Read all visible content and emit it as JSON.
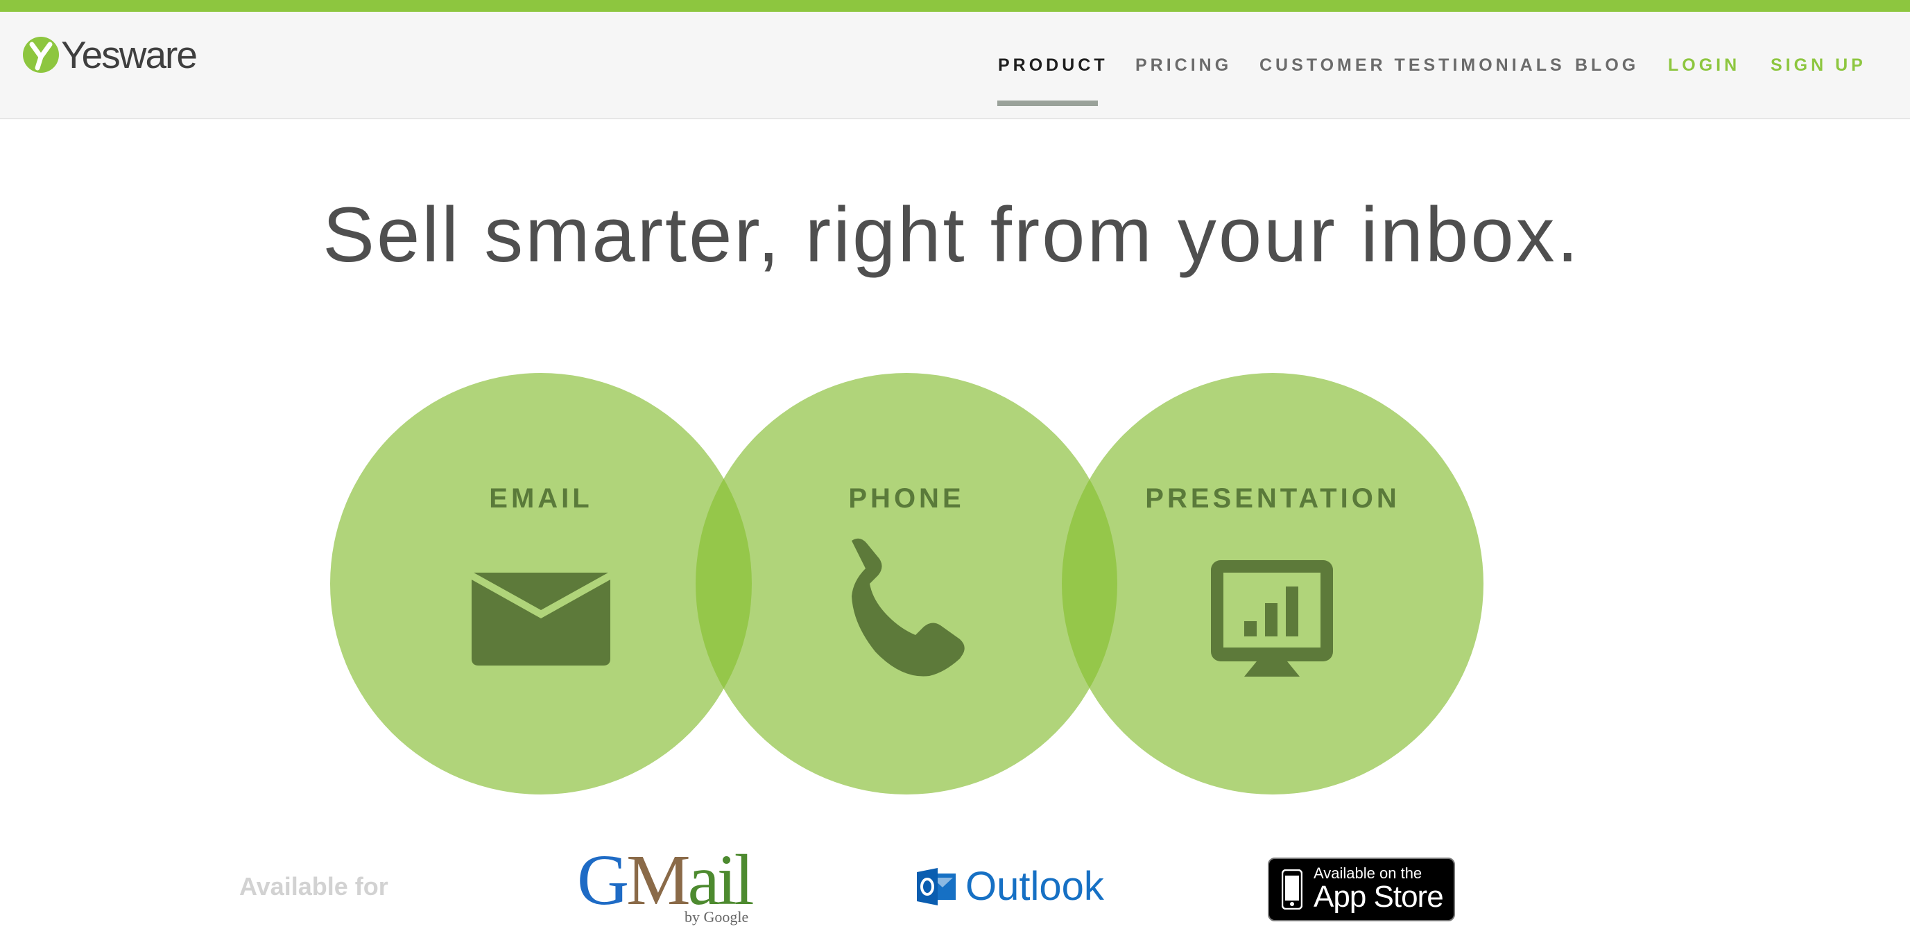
{
  "brand": {
    "name": "Yesware",
    "accent_color": "#8dc63f",
    "circle_color": "#b0d47a",
    "overlap_color": "#95c74a",
    "icon_color": "#5a7a3a"
  },
  "nav": {
    "items": [
      {
        "label": "PRODUCT",
        "active": true
      },
      {
        "label": "PRICING"
      },
      {
        "label": "CUSTOMER TESTIMONIALS"
      },
      {
        "label": "BLOG"
      },
      {
        "label": "LOGIN",
        "highlight": true
      },
      {
        "label": "SIGN UP",
        "highlight": true
      }
    ]
  },
  "hero": {
    "headline": "Sell smarter, right from your inbox."
  },
  "features": [
    {
      "label": "EMAIL",
      "icon": "envelope-icon"
    },
    {
      "label": "PHONE",
      "icon": "phone-icon"
    },
    {
      "label": "PRESENTATION",
      "icon": "monitor-chart-icon"
    }
  ],
  "platforms": {
    "intro": "Available for",
    "gmail": {
      "logo_text_g": "G",
      "logo_text_m": "M",
      "logo_text_rest": "ail",
      "byline": "by Google"
    },
    "outlook": {
      "label": "Outlook",
      "icon": "outlook-icon"
    },
    "appstore": {
      "small_text": "Available on the",
      "big_text": "App Store",
      "icon": "iphone-icon"
    }
  }
}
